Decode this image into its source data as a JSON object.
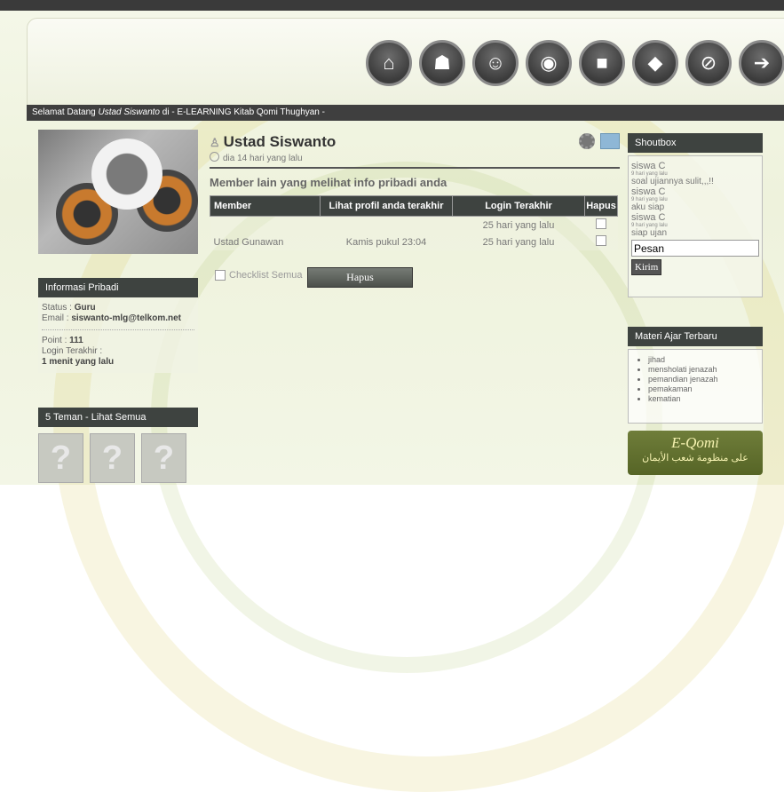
{
  "welcome": {
    "prefix": "Selamat Datang ",
    "user": "Ustad Siswanto",
    "suffix": " di - E-LEARNING Kitab Qomi Thughyan -"
  },
  "nav": [
    {
      "name": "home-icon",
      "glyph": "⌂"
    },
    {
      "name": "group-icon",
      "glyph": "☗"
    },
    {
      "name": "users-icon",
      "glyph": "☺"
    },
    {
      "name": "chat-icon",
      "glyph": "◉"
    },
    {
      "name": "book-icon",
      "glyph": "■"
    },
    {
      "name": "tag-icon",
      "glyph": "◆"
    },
    {
      "name": "attachment-icon",
      "glyph": "⊘"
    },
    {
      "name": "logout-icon",
      "glyph": "➔"
    }
  ],
  "info": {
    "title": "Informasi Pribadi",
    "status_label": "Status : ",
    "status": "Guru",
    "email_label": "Email : ",
    "email": "siswanto-mlg@telkom.net",
    "point_label": "Point : ",
    "point": "111",
    "login_label": "Login Terakhir :",
    "login": "1 menit yang lalu"
  },
  "friends": {
    "title": "5 Teman - Lihat Semua",
    "placeholder": "?"
  },
  "profile": {
    "name": "Ustad Siswanto",
    "since": "dia 14 hari yang lalu",
    "subhead": "Member lain yang melihat info pribadi anda"
  },
  "table": {
    "headers": [
      "Member",
      "Lihat profil anda terakhir",
      "Login Terakhir",
      "Hapus"
    ],
    "rows": [
      {
        "member": "",
        "viewed": "",
        "login": "25 hari yang lalu"
      },
      {
        "member": "Ustad Gunawan",
        "viewed": "Kamis pukul 23:04",
        "login": "25 hari yang lalu"
      }
    ]
  },
  "checklist_label": "Checklist Semua",
  "hapus_button": "Hapus",
  "shoutbox": {
    "title": "Shoutbox",
    "messages": [
      {
        "user": "siswa C",
        "time": "9 hari yang lalu",
        "text": "soal ujiannya sulit,,,!!"
      },
      {
        "user": "siswa C",
        "time": "9 hari yang lalu",
        "text": "aku siap"
      },
      {
        "user": "siswa C",
        "time": "9 hari yang lalu",
        "text": "siap ujan"
      }
    ],
    "input_value": "Pesan",
    "send_label": "Kirim"
  },
  "materi": {
    "title": "Materi Ajar Terbaru",
    "items": [
      "jihad",
      "mensholati jenazah",
      "pemandian jenazah",
      "pemakaman",
      "kematian"
    ]
  },
  "banner": {
    "title": "E-Qomi",
    "subtitle": "على منظومة شعب الأيمان"
  }
}
